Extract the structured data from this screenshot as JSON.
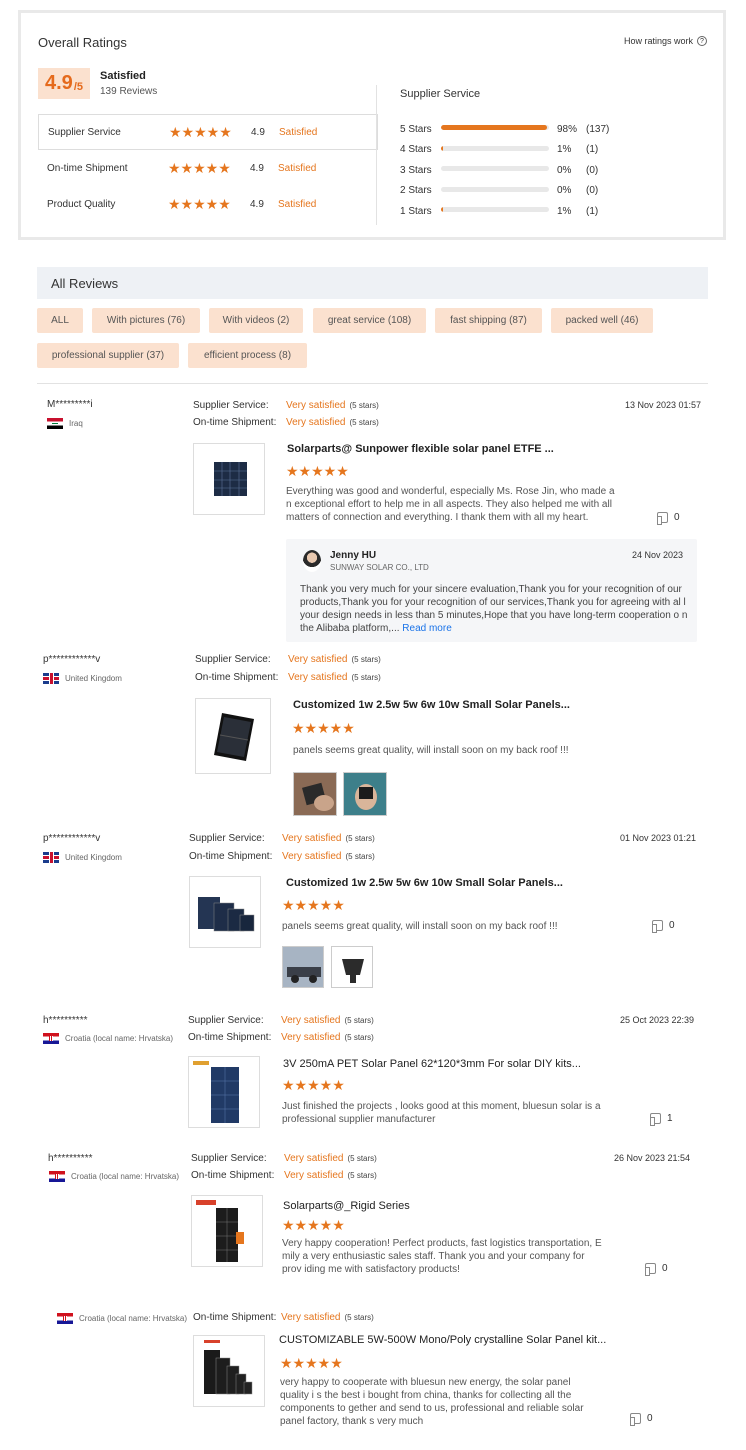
{
  "overall": {
    "title": "Overall Ratings",
    "how_link": "How ratings work",
    "score": "4.9",
    "score_denominator": "/5",
    "score_label": "Satisfied",
    "review_count": "139 Reviews",
    "rows": [
      {
        "label": "Supplier Service",
        "stars": "★★★★★",
        "score": "4.9",
        "status": "Satisfied"
      },
      {
        "label": "On-time Shipment",
        "stars": "★★★★★",
        "score": "4.9",
        "status": "Satisfied"
      },
      {
        "label": "Product Quality",
        "stars": "★★★★★",
        "score": "4.9",
        "status": "Satisfied"
      }
    ],
    "distribution_title": "Supplier Service",
    "distribution": [
      {
        "label": "5 Stars",
        "fraction": 0.98,
        "pct": "98%",
        "count": "(137)"
      },
      {
        "label": "4 Stars",
        "fraction": 0.01,
        "pct": "1%",
        "count": "(1)"
      },
      {
        "label": "3 Stars",
        "fraction": 0,
        "pct": "0%",
        "count": "(0)"
      },
      {
        "label": "2 Stars",
        "fraction": 0,
        "pct": "0%",
        "count": "(0)"
      },
      {
        "label": "1 Stars",
        "fraction": 0.01,
        "pct": "1%",
        "count": "(1)"
      }
    ]
  },
  "all_reviews": {
    "title": "All Reviews",
    "filters": [
      "ALL",
      "With pictures (76)",
      "With videos (2)",
      "great service (108)",
      "fast shipping (87)",
      "packed well (46)",
      "professional supplier (37)",
      "efficient process (8)"
    ]
  },
  "labels": {
    "supplier_service": "Supplier Service:",
    "ontime_shipment": "On-time Shipment:",
    "very_satisfied": "Very satisfied",
    "five_stars": "(5 stars)",
    "stars": "★★★★★"
  },
  "reviews": [
    {
      "user": "M*********i",
      "country": "Iraq",
      "date": "13 Nov 2023 01:57",
      "product": "Solarparts@ Sunpower flexible solar panel ETFE ...",
      "text": "Everything was good and wonderful, especially Ms. Rose Jin, who made a n exceptional effort to help me in all aspects. They also helped me with all matters of connection and everything. I thank them with all my heart.",
      "likes": "0",
      "reply": {
        "name": "Jenny HU",
        "company": "SUNWAY SOLAR CO., LTD",
        "date": "24 Nov 2023",
        "text": "Thank you very much for your sincere evaluation,Thank you for your recognition of our products,Thank you for your recognition of our services,Thank you for agreeing with al l your design needs in less than 5 minutes,Hope that you have long-term cooperation o n the Alibaba platform,...",
        "read_more": "Read more"
      }
    },
    {
      "user": "p************v",
      "country": "United Kingdom",
      "product": "Customized 1w 2.5w 5w 6w 10w Small Solar Panels...",
      "text": "panels seems great quality, will install soon on my back roof !!!"
    },
    {
      "user": "p************v",
      "country": "United Kingdom",
      "date": "01 Nov 2023 01:21",
      "product": "Customized 1w 2.5w 5w 6w 10w Small Solar Panels...",
      "text": "panels seems great quality, will install soon on my back roof !!!",
      "likes": "0"
    },
    {
      "user": "h**********",
      "country": "Croatia (local name: Hrvatska)",
      "date": "25 Oct 2023 22:39",
      "product": "3V 250mA PET Solar Panel 62*120*3mm For solar DIY kits...",
      "text": "Just finished the projects , looks good at this moment, bluesun solar is a professional supplier manufacturer",
      "likes": "1"
    },
    {
      "user": "h**********",
      "country": "Croatia (local name: Hrvatska)",
      "date": "26 Nov 2023 21:54",
      "product": "Solarparts@_Rigid Series",
      "text": "Very happy cooperation! Perfect products, fast logistics transportation, E mily a very enthusiastic sales staff. Thank you and your company for prov iding me with satisfactory products!",
      "likes": "0"
    },
    {
      "country": "Croatia (local name: Hrvatska)",
      "product": "CUSTOMIZABLE 5W-500W Mono/Poly crystalline Solar Panel kit...",
      "text": "very happy to cooperate with bluesun new energy, the solar panel quality i s the best i bought from china, thanks for collecting all the components to gether and send to us, professional and reliable solar panel factory, thank s very much",
      "likes": "0"
    }
  ],
  "colors": {
    "accent": "#e5761e",
    "chip_bg": "#fbe1cf",
    "header_bg": "#eef1f5"
  }
}
